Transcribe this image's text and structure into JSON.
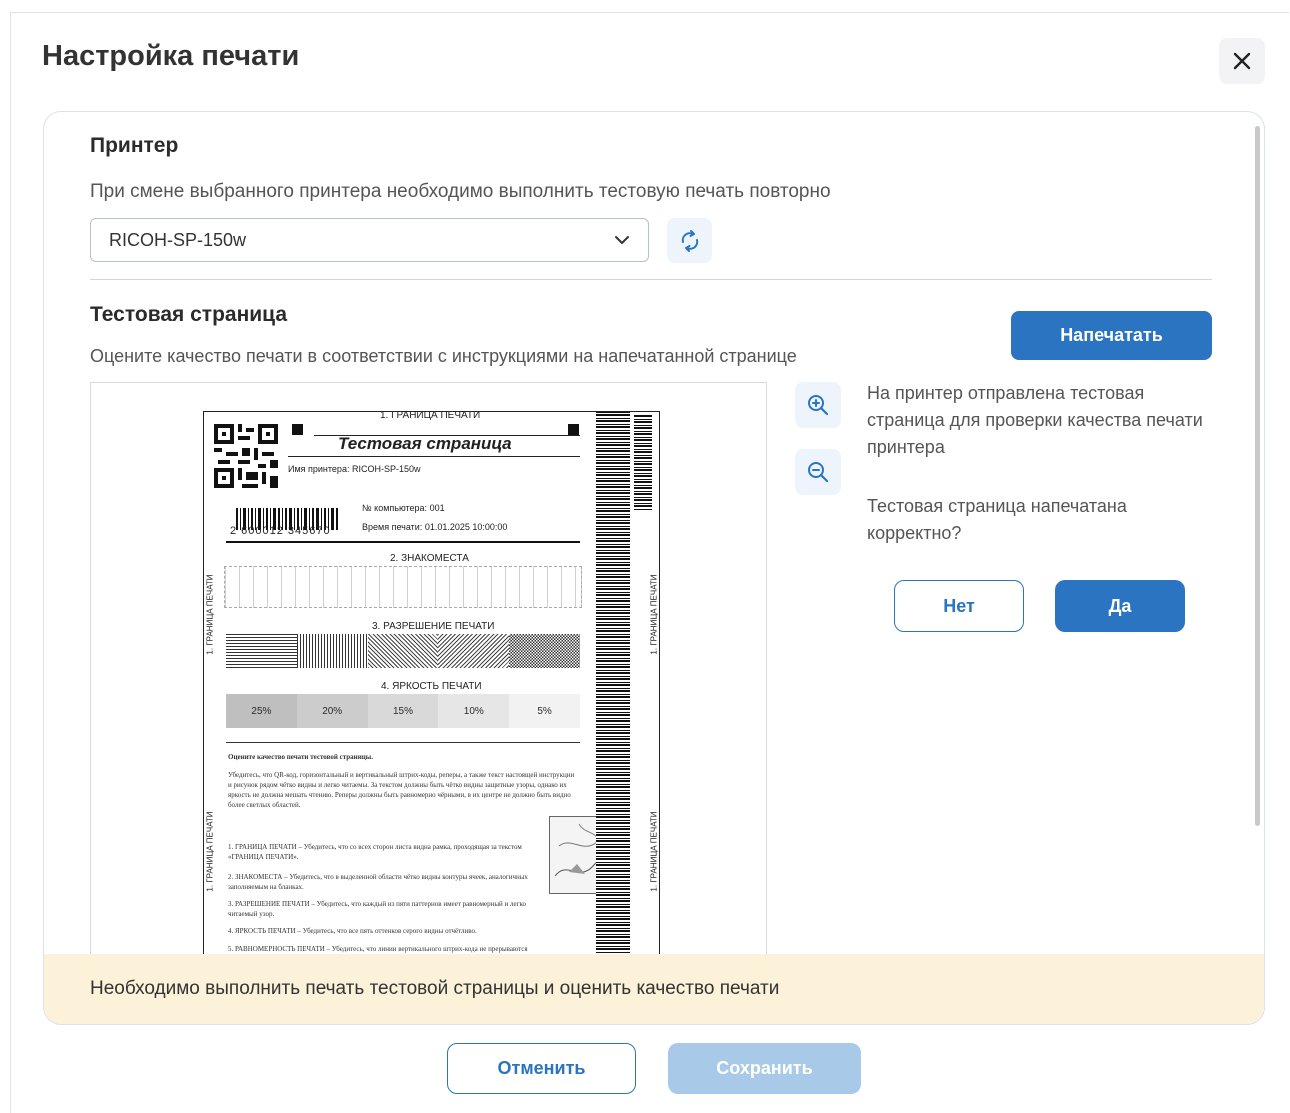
{
  "dialog": {
    "title": "Настройка печати"
  },
  "printer": {
    "heading": "Принтер",
    "hint": "При смене выбранного принтера необходимо выполнить тестовую печать повторно",
    "selected": "RICOH-SP-150w"
  },
  "test_page": {
    "heading": "Тестовая страница",
    "hint": "Оцените качество печати в соответствии с инструкциями на напечатанной странице",
    "print_label": "Напечатать",
    "info_sent": "На принтер отправлена тестовая страница для проверки качества печати принтера",
    "question": "Тестовая страница напечатана корректно?",
    "no_label": "Нет",
    "yes_label": "Да"
  },
  "sheet": {
    "border_label": "1. ГРАНИЦА ПЕЧАТИ",
    "title": "Тестовая страница",
    "printer_name_label": "Имя принтера:",
    "printer_name_value": "RICOH-SP-150w",
    "computer_label": "№ компьютера:",
    "computer_value": "001",
    "time_label": "Время печати:",
    "time_value": "01.01.2025 10:00:00",
    "barcode_number": "2 600012 345670",
    "section2": "2. ЗНАКОМЕСТА",
    "section3": "3. РАЗРЕШЕНИЕ ПЕЧАТИ",
    "section4": "4. ЯРКОСТЬ ПЕЧАТИ",
    "brightness": [
      "25%",
      "20%",
      "15%",
      "10%",
      "5%"
    ],
    "instructions_title": "Оцените качество печати тестовой страницы.",
    "instructions_text": "Убедитесь, что QR-код, горизонтальный и вертикальный штрих-коды, реперы, а также текст настоящей инструкции и рисунок рядом чётко видны и легко читаемы. За текстом должны быть чётко видны защитные узоры, однако их яркость не должна мешать чтению. Реперы должны быть равномерно чёрными, в их центре не должно быть видно более светлых областей.",
    "item1": "1. ГРАНИЦА ПЕЧАТИ – Убедитесь, что со всех сторон листа видна рамка, проходящая за текстом «ГРАНИЦА ПЕЧАТИ».",
    "item2": "2. ЗНАКОМЕСТА – Убедитесь, что в выделенной области чётко видны контуры ячеек, аналогичных заполняемым на бланках.",
    "item3": "3. РАЗРЕШЕНИЕ ПЕЧАТИ – Убедитесь, что каждый из пяти паттернов имеет равномерный и легко читаемый узор.",
    "item4": "4. ЯРКОСТЬ ПЕЧАТИ – Убедитесь, что все пять оттенков серого видны отчётливо.",
    "item5": "5. РАВНОМЕРНОСТЬ ПЕЧАТИ – Убедитесь, что линии вертикального штрих-кода не прерываются"
  },
  "warning": "Необходимо выполнить печать тестовой страницы и оценить качество печати",
  "footer": {
    "cancel_label": "Отменить",
    "save_label": "Сохранить"
  },
  "colors": {
    "primary": "#2a74c2",
    "disabled": "#a9c9e8",
    "warning_bg": "#fcf2d9"
  },
  "icons": [
    "close-icon",
    "chevron-down-icon",
    "refresh-icon",
    "zoom-in-icon",
    "zoom-out-icon"
  ]
}
